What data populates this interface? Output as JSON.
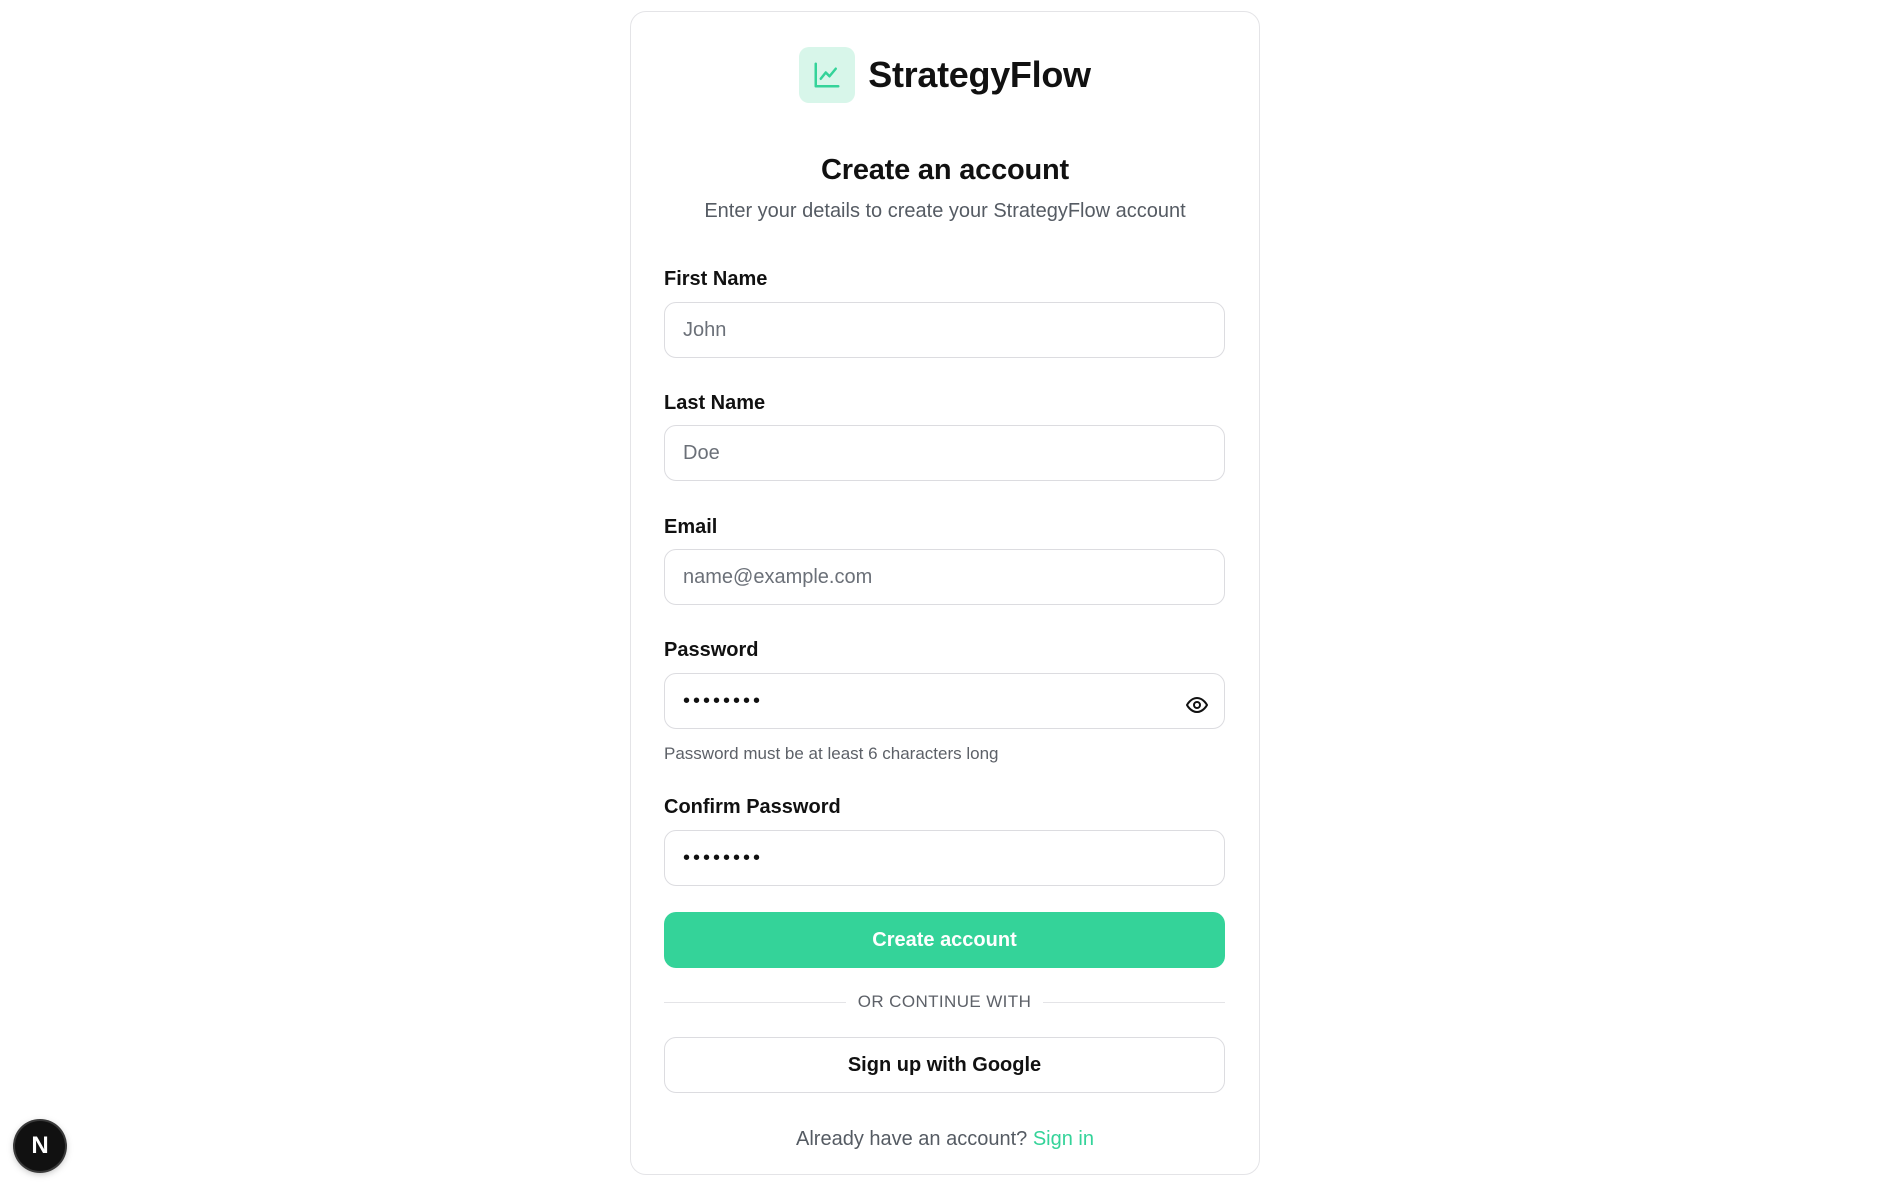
{
  "brand": {
    "name": "StrategyFlow",
    "icon": "line-chart-icon",
    "accent_color": "#34d399"
  },
  "form": {
    "title": "Create an account",
    "subtitle": "Enter your details to create your StrategyFlow account",
    "first_name": {
      "label": "First Name",
      "placeholder": "John",
      "value": ""
    },
    "last_name": {
      "label": "Last Name",
      "placeholder": "Doe",
      "value": ""
    },
    "email": {
      "label": "Email",
      "placeholder": "name@example.com",
      "value": ""
    },
    "password": {
      "label": "Password",
      "masked_value": "••••••••",
      "hint": "Password must be at least 6 characters long",
      "toggle_icon": "eye-icon"
    },
    "confirm_password": {
      "label": "Confirm Password",
      "masked_value": "••••••••"
    },
    "submit_label": "Create account",
    "divider_text": "OR CONTINUE WITH",
    "google_label": "Sign up with Google",
    "footer_text": "Already have an account?",
    "signin_label": "Sign in"
  },
  "devtools": {
    "badge_letter": "N",
    "icon": "nextjs-icon"
  }
}
